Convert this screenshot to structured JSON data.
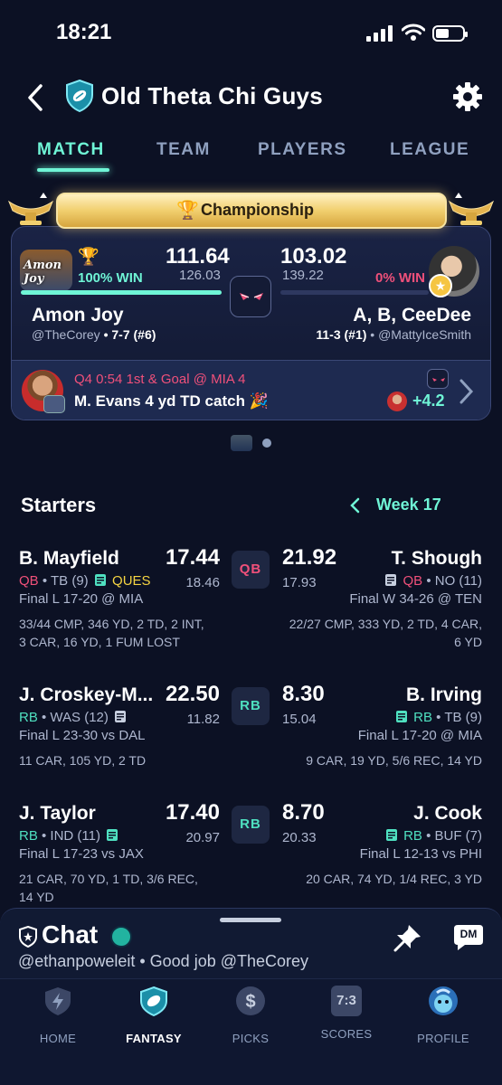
{
  "status": {
    "time": "18:21"
  },
  "header": {
    "title": "Old Theta Chi Guys"
  },
  "tabs": [
    "MATCH",
    "TEAM",
    "PLAYERS",
    "LEAGUE"
  ],
  "banner": {
    "label": "Championship"
  },
  "matchup": {
    "left": {
      "name": "Amon Joy",
      "handle": "@TheCorey",
      "record": "• 7-7 (#6)",
      "score": "111.64",
      "projected": "126.03",
      "win_pct": "100%",
      "win_label": "WIN",
      "avatar_text": "Amon Joy",
      "win_fraction": 1.0
    },
    "right": {
      "name": "A, B, CeeDee",
      "handle": "• @MattyIceSmith",
      "record": "11-3 (#1)",
      "score": "103.02",
      "projected": "139.22",
      "win_pct": "0%",
      "win_label": "WIN",
      "win_fraction": 0.0
    }
  },
  "last_play": {
    "situation": "Q4 0:54 1st & Goal @ MIA 4",
    "description": "M. Evans 4 yd TD catch 🎉",
    "points": "+4.2"
  },
  "starters": {
    "title": "Starters",
    "week": "Week 17",
    "rows": [
      {
        "pos": "QB",
        "left": {
          "name": "B. Mayfield",
          "pos": "QB",
          "team": "• TB (9)",
          "status": "QUES",
          "pts": "17.44",
          "proj": "18.46",
          "game": "Final L 17-20 @ MIA",
          "stats1": "33/44 CMP, 346 YD, 2 TD, 2 INT,",
          "stats2": "3 CAR, 16 YD, 1 FUM LOST"
        },
        "right": {
          "name": "T. Shough",
          "pos": "QB",
          "team": "• NO (11)",
          "pts": "21.92",
          "proj": "17.93",
          "game": "Final W 34-26 @ TEN",
          "stats1": "22/27 CMP, 333 YD, 2 TD, 4 CAR,",
          "stats2": "6 YD"
        }
      },
      {
        "pos": "RB",
        "left": {
          "name": "J. Croskey-M...",
          "pos": "RB",
          "team": "• WAS (12)",
          "pts": "22.50",
          "proj": "11.82",
          "game": "Final L 23-30 vs DAL",
          "stats1": "11 CAR, 105 YD, 2 TD",
          "stats2": ""
        },
        "right": {
          "name": "B. Irving",
          "pos": "RB",
          "team": "• TB (9)",
          "pts": "8.30",
          "proj": "15.04",
          "game": "Final L 17-20 @ MIA",
          "stats1": "9 CAR, 19 YD, 5/6 REC, 14 YD",
          "stats2": ""
        }
      },
      {
        "pos": "RB",
        "left": {
          "name": "J. Taylor",
          "pos": "RB",
          "team": "• IND (11)",
          "pts": "17.40",
          "proj": "20.97",
          "game": "Final L 17-23 vs JAX",
          "stats1": "21 CAR, 70 YD, 1 TD, 3/6 REC,",
          "stats2": "14 YD"
        },
        "right": {
          "name": "J. Cook",
          "pos": "RB",
          "team": "• BUF (7)",
          "pts": "8.70",
          "proj": "20.33",
          "game": "Final L 12-13 vs PHI",
          "stats1": "20 CAR, 74 YD, 1/4 REC, 3 YD",
          "stats2": ""
        }
      }
    ]
  },
  "chat": {
    "title": "Chat",
    "message": "@ethanpoweleit • Good job @TheCorey",
    "dm_label": "DM"
  },
  "nav": [
    {
      "label": "HOME",
      "icon": "home-shield-icon"
    },
    {
      "label": "FANTASY",
      "icon": "football-shield-icon",
      "active": true
    },
    {
      "label": "PICKS",
      "icon": "dollar-coin-icon"
    },
    {
      "label": "SCORES",
      "icon": "scoreboard-icon",
      "score_text": "7:3"
    },
    {
      "label": "PROFILE",
      "icon": "avatar-icon"
    }
  ],
  "colors": {
    "accent": "#6ff5d6",
    "loss": "#f0507a",
    "qb": "#f0507a",
    "rb": "#4fe0c0",
    "ques": "#f5d442",
    "bg": "#0c1124"
  }
}
